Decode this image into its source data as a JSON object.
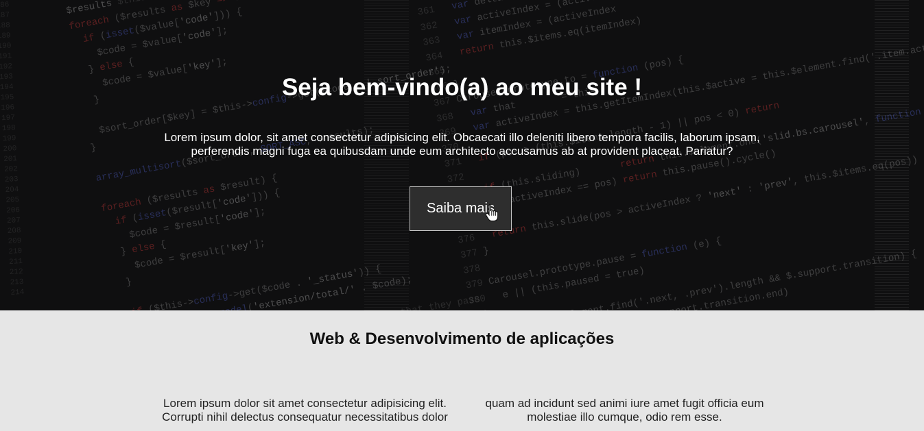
{
  "hero": {
    "title": "Seja bem-vindo(a) ao meu site !",
    "text": "Lorem ipsum dolor, sit amet consectetur adipisicing elit. Obcaecati illo deleniti libero tempora facilis, laborum ipsam, perferendis magni fuga ea quibusdam unde eum architecto accusamus ab at provident placeat. Pariatur?",
    "button_label": "Saiba mais"
  },
  "section": {
    "title": "Web & Desenvolvimento de aplicações",
    "columns": [
      {
        "text": "Lorem ipsum dolor sit amet consectetur adipisicing elit. Corrupti nihil delectus consequatur necessitatibus dolor"
      },
      {
        "text": "quam ad incidunt sed animi iure amet fugit officia eum molestiae illo cumque, odio rem esse."
      }
    ]
  },
  "icons": {
    "cursor": "hand-pointer-icon"
  },
  "colors": {
    "hero_bg": "#0f0f10",
    "button_bg": "#2e2e2e",
    "section_bg": "#e6e6e6"
  }
}
